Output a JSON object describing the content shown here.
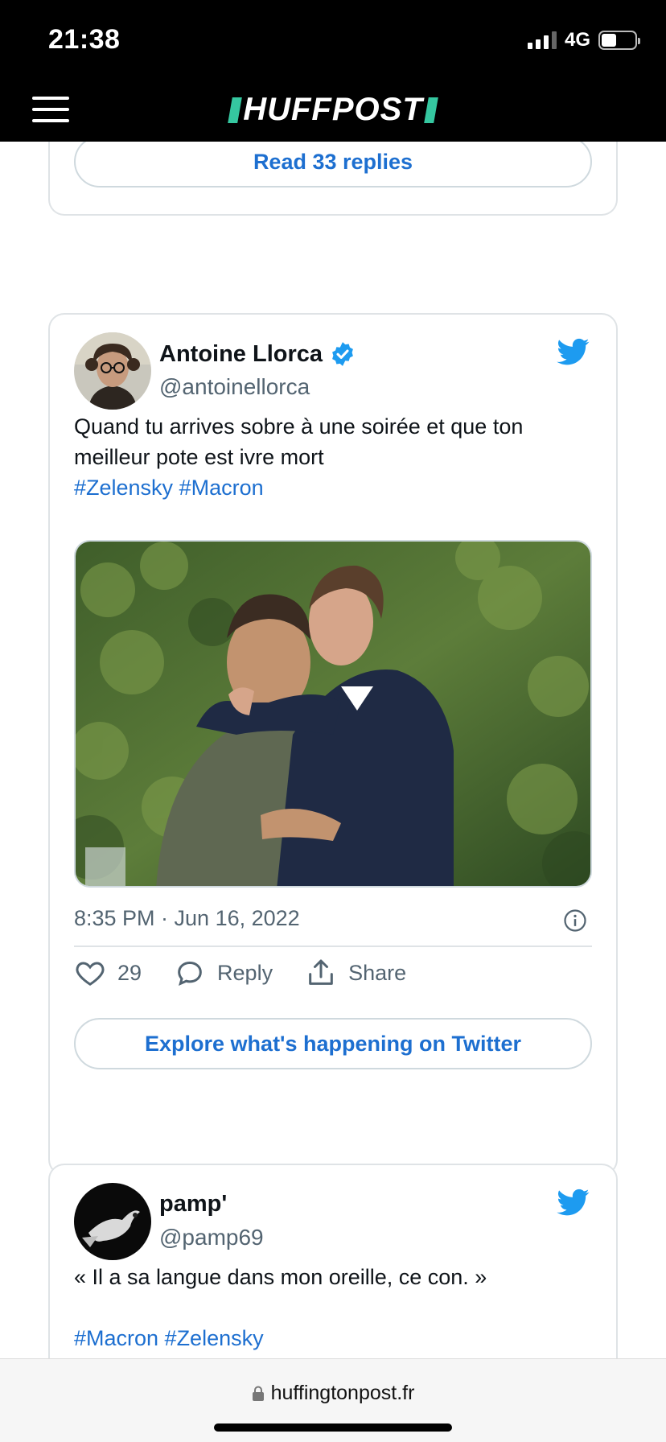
{
  "status_bar": {
    "time": "21:38",
    "network": "4G"
  },
  "header": {
    "logo_text": "HUFFPOST",
    "menu_icon": "hamburger-menu-icon"
  },
  "prev_card": {
    "read_replies_label": "Read 33 replies"
  },
  "tweet_main": {
    "author_name": "Antoine Llorca",
    "verified": true,
    "handle": "@antoinellorca",
    "text": "Quand tu arrives sobre à une soirée et que ton meilleur pote est ivre mort",
    "hashtags": [
      "#Zelensky",
      "#Macron"
    ],
    "timestamp": "8:35 PM · Jun 16, 2022",
    "likes": "29",
    "reply_label": "Reply",
    "share_label": "Share",
    "explore_label": "Explore what's happening on Twitter"
  },
  "tweet_next": {
    "author_name": "pamp'",
    "handle": "@pamp69",
    "text": "« Il a sa langue dans mon oreille, ce con. »",
    "hashtags_line": "#Macron #Zelensky"
  },
  "browser": {
    "url": "huffingtonpost.fr"
  },
  "colors": {
    "link": "#1d6fd0",
    "twitter_blue": "#1d9bf0",
    "logo_accent": "#35c7a0"
  }
}
